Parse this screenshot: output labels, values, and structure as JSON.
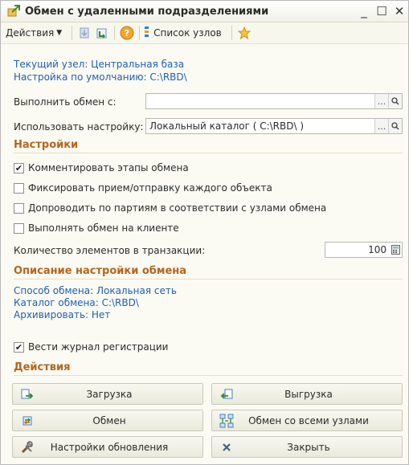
{
  "window": {
    "title": "Обмен с удаленными подразделениями",
    "minimize": "_",
    "maximize": "☐",
    "close": "✕"
  },
  "toolbar": {
    "actions_label": "Действия",
    "node_list_label": "Список узлов",
    "icons": [
      "arrow-down-icon",
      "load-icon",
      "help-icon",
      "list-icon",
      "star-icon"
    ]
  },
  "info": {
    "current_node": "Текущий узел: Центральная база",
    "default_setting": "Настройка по умолчанию: C:\\RBD\\"
  },
  "form": {
    "exchange_with_label": "Выполнить обмен с:",
    "exchange_with_value": "",
    "use_setting_label": "Использовать настройку:",
    "use_setting_value": "Локальный каталог ( C:\\RBD\\ )",
    "ellipsis": "...",
    "search_glyph": "🔍"
  },
  "settings": {
    "title": "Настройки",
    "checkboxes": [
      {
        "label": "Комментировать этапы обмена",
        "checked": true
      },
      {
        "label": "Фиксировать прием/отправку каждого объекта",
        "checked": false
      },
      {
        "label": "Допроводить по партиям в соответствии с узлами обмена",
        "checked": false
      },
      {
        "label": "Выполнять обмен на клиенте",
        "checked": false
      }
    ],
    "transaction_label": "Количество элементов в транзакции:",
    "transaction_value": "100"
  },
  "description": {
    "title": "Описание настройки обмена",
    "method": "Способ обмена: Локальная сеть",
    "catalog": "Каталог обмена: C:\\RBD\\",
    "archive": "Архивировать: Нет",
    "journal_label": "Вести журнал регистрации",
    "journal_checked": true
  },
  "actions": {
    "title": "Действия",
    "load": "Загрузка",
    "unload": "Выгрузка",
    "exchange": "Обмен",
    "exchange_all": "Обмен со всеми узлами",
    "update_settings": "Настройки обновления",
    "close": "Закрыть"
  },
  "colors": {
    "accent_orange": "#b5651d",
    "info_blue": "#1f5fb5",
    "background": "#fbfbf3"
  }
}
